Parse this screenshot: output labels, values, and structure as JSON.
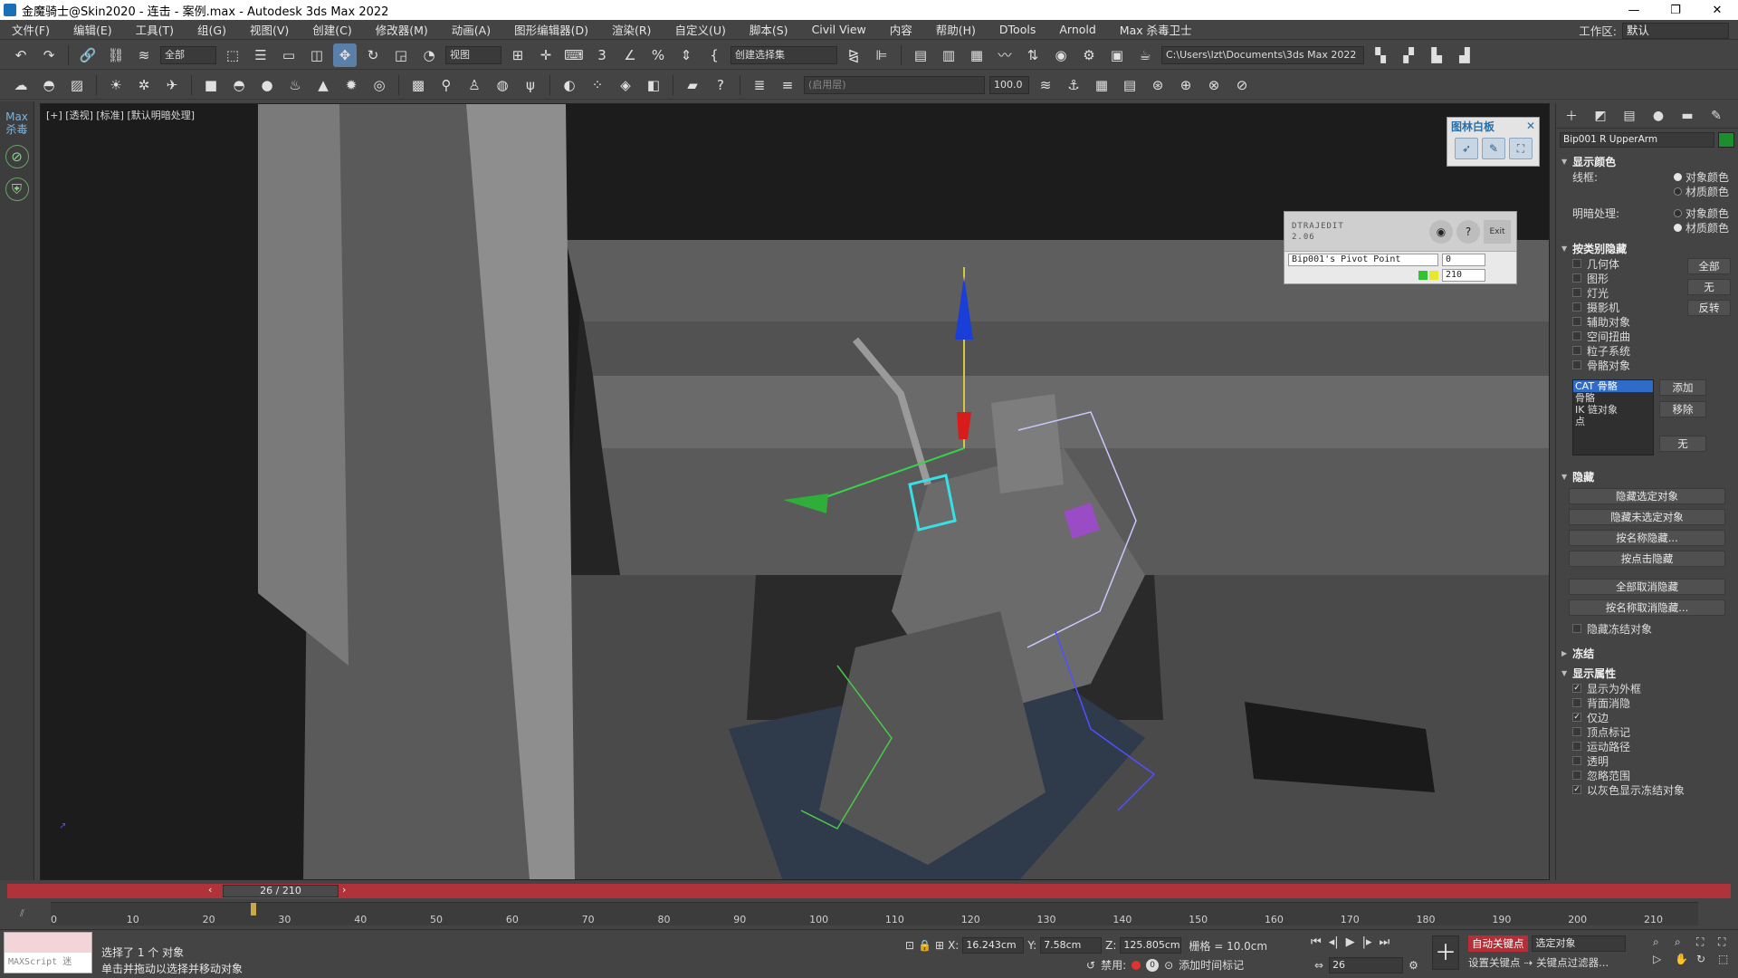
{
  "window": {
    "title": "金魔骑士@Skin2020 - 连击 - 案例.max - Autodesk 3ds Max 2022",
    "controls": [
      "—",
      "❐",
      "✕"
    ]
  },
  "menubar": {
    "items": [
      "文件(F)",
      "编辑(E)",
      "工具(T)",
      "组(G)",
      "视图(V)",
      "创建(C)",
      "修改器(M)",
      "动画(A)",
      "图形编辑器(D)",
      "渲染(R)",
      "自定义(U)",
      "脚本(S)",
      "Civil View",
      "内容",
      "帮助(H)",
      "DTools",
      "Arnold",
      "Max 杀毒卫士"
    ],
    "workspace_label": "工作区:",
    "workspace_value": "默认"
  },
  "toolbar1": {
    "filter_dropdown": "全部",
    "ref_coord_dropdown": "视图",
    "selection_set_dropdown": "创建选择集",
    "project_path": "C:\\Users\\lzt\\Documents\\3ds Max 2022"
  },
  "toolbar2": {
    "layer_dropdown": "(启用层)",
    "value_field": "100.0"
  },
  "left_strip": {
    "label": "Max 杀毒"
  },
  "viewport": {
    "label": "[+] [透视] [标准] [默认明暗处理]"
  },
  "whiteboard": {
    "title": "图林白板",
    "close": "✕"
  },
  "dtrajedit": {
    "name_line1": "DTRAJEDIT",
    "name_line2": "2.06",
    "pivot_field": "Bip001's Pivot Point",
    "start_value": "0",
    "end_value": "210",
    "exit_label": "Exit"
  },
  "command_panel": {
    "object_name": "Bip001 R UpperArm",
    "swatch_color": "#1c8f2c",
    "display_color": {
      "header": "显示颜色",
      "wireframe_label": "线框:",
      "shaded_label": "明暗处理:",
      "option_object": "对象颜色",
      "option_material": "材质颜色"
    },
    "hide_by_category": {
      "header": "按类别隐藏",
      "items": [
        "几何体",
        "图形",
        "灯光",
        "摄影机",
        "辅助对象",
        "空间扭曲",
        "粒子系统",
        "骨骼对象"
      ],
      "btn_all": "全部",
      "btn_none": "无",
      "btn_invert": "反转",
      "list_items": [
        "CAT 骨骼",
        "骨骼",
        "IK 链对象",
        "点"
      ],
      "btn_add": "添加",
      "btn_remove": "移除",
      "btn_none2": "无"
    },
    "hide": {
      "header": "隐藏",
      "buttons": [
        "隐藏选定对象",
        "隐藏未选定对象",
        "按名称隐藏...",
        "按点击隐藏",
        "全部取消隐藏",
        "按名称取消隐藏...",
        "隐藏冻结对象"
      ]
    },
    "freeze": {
      "header": "冻结"
    },
    "display_props": {
      "header": "显示属性",
      "items": [
        {
          "label": "显示为外框",
          "checked": true
        },
        {
          "label": "背面消隐",
          "checked": false
        },
        {
          "label": "仅边",
          "checked": true
        },
        {
          "label": "顶点标记",
          "checked": false
        },
        {
          "label": "运动路径",
          "checked": false
        },
        {
          "label": "透明",
          "checked": false
        },
        {
          "label": "忽略范围",
          "checked": false
        },
        {
          "label": "以灰色显示冻结对象",
          "checked": true
        }
      ]
    }
  },
  "timeline": {
    "frame_display": "26 / 210",
    "current_frame": 26,
    "total_frames": 210,
    "ticks": [
      "0",
      "10",
      "20",
      "30",
      "40",
      "50",
      "60",
      "70",
      "80",
      "90",
      "100",
      "110",
      "120",
      "130",
      "140",
      "150",
      "160",
      "170",
      "180",
      "190",
      "200",
      "210"
    ]
  },
  "status": {
    "maxscript_label": "MAXScript 迷",
    "selection_text": "选择了 1 个 对象",
    "hint_text": "单击并拖动以选择并移动对象",
    "x_label": "X:",
    "x_value": "16.243cm",
    "y_label": "Y:",
    "y_value": "7.58cm",
    "z_label": "Z:",
    "z_value": "125.805cm",
    "grid_label": "栅格 = 10.0cm",
    "disable_label": "禁用:",
    "add_time_tag": "添加时间标记",
    "auto_key": "自动关键点",
    "set_key": "设置关键点",
    "selected_dropdown": "选定对象",
    "key_filters": "关键点过滤器...",
    "frame_field": "26"
  }
}
